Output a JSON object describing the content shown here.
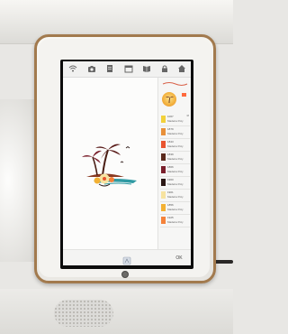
{
  "toolbar": {
    "icons": [
      "wifi-icon",
      "camera-icon",
      "document-icon",
      "calendar-icon",
      "book-icon",
      "lock-icon",
      "home-icon"
    ]
  },
  "side_panel": {
    "thread_colors": [
      {
        "code": "1067",
        "name": "Madeira Poly",
        "tag": "38",
        "color": "#f2d13a"
      },
      {
        "code": "1879",
        "name": "Madeira Poly",
        "tag": "",
        "color": "#e8903a"
      },
      {
        "code": "1843",
        "name": "Madeira Poly",
        "tag": "",
        "color": "#e9542f"
      },
      {
        "code": "1839",
        "name": "Madeira Poly",
        "tag": "",
        "color": "#5b2a1c"
      },
      {
        "code": "1866",
        "name": "Madeira Poly",
        "tag": "",
        "color": "#7a1f2b"
      },
      {
        "code": "1960",
        "name": "Madeira Poly",
        "tag": "",
        "color": "#2a1714"
      },
      {
        "code": "1901",
        "name": "Madeira Poly",
        "tag": "",
        "color": "#f7e3a0"
      },
      {
        "code": "1856",
        "name": "Madeira Poly",
        "tag": "",
        "color": "#f3b133"
      },
      {
        "code": "1925",
        "name": "Madeira Poly",
        "tag": "",
        "color": "#f5823a"
      }
    ]
  },
  "bottom_bar": {
    "ok_label": "OK"
  }
}
